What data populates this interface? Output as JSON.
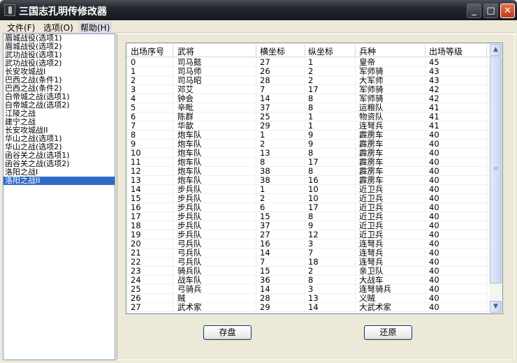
{
  "window": {
    "title": "三国志孔明传修改器",
    "minimize": "_",
    "maximize": "□",
    "close": "✕"
  },
  "menu": [
    {
      "label": "文件(F)"
    },
    {
      "label": "选项(O)"
    },
    {
      "label": "帮助(H)"
    }
  ],
  "battles": [
    "眉城战役(选项1)",
    "眉城战役(选项2)",
    "武功战役(选项1)",
    "武功战役(选项2)",
    "长安攻城战I",
    "巴西之战(条件1)",
    "巴西之战(条件2)",
    "白帝城之战(选项1)",
    "白帝城之战(选项2)",
    "江陵之战",
    "建宁之战",
    "长安攻城战II",
    "华山之战(选项1)",
    "华山之战(选项2)",
    "函谷关之战(选项1)",
    "函谷关之战(选项2)",
    "洛阳之战I",
    "洛阳之战II"
  ],
  "selected_battle": "洛阳之战II",
  "table": {
    "columns": [
      "出场序号",
      "武将",
      "横坐标",
      "纵坐标",
      "兵种",
      "出场等级"
    ],
    "rows": [
      [
        "0",
        "司马懿",
        "27",
        "1",
        "皇帝",
        "45"
      ],
      [
        "1",
        "司马师",
        "26",
        "2",
        "军师骑",
        "43"
      ],
      [
        "2",
        "司马昭",
        "28",
        "2",
        "大军师",
        "43"
      ],
      [
        "3",
        "邓艾",
        "7",
        "17",
        "军师骑",
        "42"
      ],
      [
        "4",
        "钟会",
        "14",
        "8",
        "军师骑",
        "42"
      ],
      [
        "5",
        "辛毗",
        "37",
        "8",
        "运粮队",
        "41"
      ],
      [
        "6",
        "陈群",
        "25",
        "1",
        "物资队",
        "41"
      ],
      [
        "7",
        "华歆",
        "29",
        "1",
        "连弩兵",
        "41"
      ],
      [
        "8",
        "炮车队",
        "1",
        "9",
        "霹雳车",
        "40"
      ],
      [
        "9",
        "炮车队",
        "2",
        "9",
        "霹雳车",
        "40"
      ],
      [
        "10",
        "炮车队",
        "13",
        "8",
        "霹雳车",
        "40"
      ],
      [
        "11",
        "炮车队",
        "8",
        "17",
        "霹雳车",
        "40"
      ],
      [
        "12",
        "炮车队",
        "38",
        "8",
        "霹雳车",
        "40"
      ],
      [
        "13",
        "炮车队",
        "38",
        "16",
        "霹雳车",
        "40"
      ],
      [
        "14",
        "步兵队",
        "1",
        "10",
        "近卫兵",
        "40"
      ],
      [
        "15",
        "步兵队",
        "2",
        "10",
        "近卫兵",
        "40"
      ],
      [
        "16",
        "步兵队",
        "6",
        "17",
        "近卫兵",
        "40"
      ],
      [
        "17",
        "步兵队",
        "15",
        "8",
        "近卫兵",
        "40"
      ],
      [
        "18",
        "步兵队",
        "37",
        "9",
        "近卫兵",
        "40"
      ],
      [
        "19",
        "步兵队",
        "27",
        "12",
        "近卫兵",
        "40"
      ],
      [
        "20",
        "弓兵队",
        "16",
        "3",
        "连弩兵",
        "40"
      ],
      [
        "21",
        "弓兵队",
        "14",
        "7",
        "连弩兵",
        "40"
      ],
      [
        "22",
        "弓兵队",
        "7",
        "18",
        "连弩兵",
        "40"
      ],
      [
        "23",
        "骑兵队",
        "15",
        "2",
        "亲卫队",
        "40"
      ],
      [
        "24",
        "战车队",
        "36",
        "8",
        "大战车",
        "40"
      ],
      [
        "25",
        "弓骑兵",
        "14",
        "3",
        "连弩骑兵",
        "40"
      ],
      [
        "26",
        "贼",
        "28",
        "13",
        "义贼",
        "40"
      ],
      [
        "27",
        "武术家",
        "29",
        "14",
        "大武术家",
        "40"
      ]
    ]
  },
  "buttons": {
    "save": "存盘",
    "restore": "还原"
  }
}
